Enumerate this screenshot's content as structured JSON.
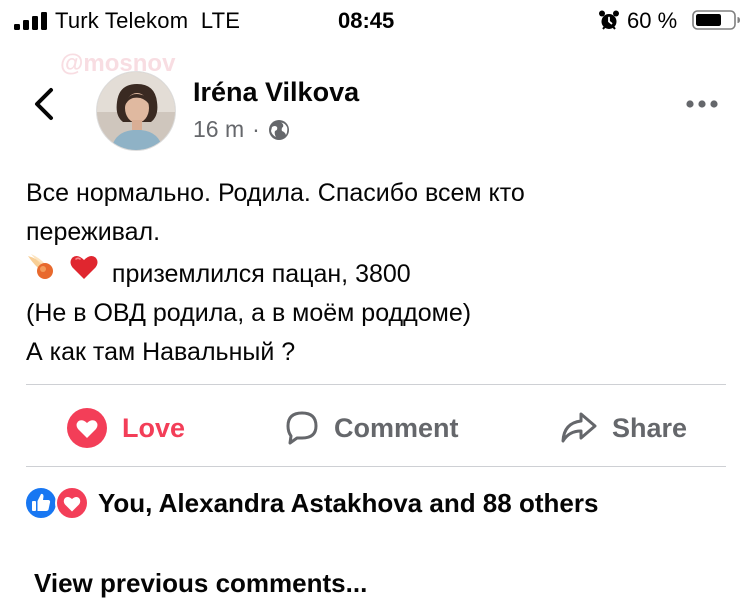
{
  "status_bar": {
    "carrier": "Turk Telekom",
    "network": "LTE",
    "time": "08:45",
    "battery_percent": "60 %"
  },
  "watermark": "@mosnov",
  "post": {
    "author": "Iréna Vilkova",
    "time_ago": "16 m",
    "separator": "·",
    "privacy_icon": "globe-icon",
    "lines": [
      "Все нормально. Родила. Спасибо всем кто",
      "переживал.",
      "приземлился пацан, 3800",
      "(Не в ОВД родила, а в моём роддоме)",
      "А как там Навальный ?"
    ],
    "emojis": [
      "comet-icon",
      "red-heart-icon"
    ]
  },
  "actions": {
    "love": "Love",
    "comment": "Comment",
    "share": "Share"
  },
  "reactions": {
    "summary": "You, Alexandra Astakhova and 88 others",
    "icons": [
      "like-icon",
      "love-icon"
    ]
  },
  "comments": {
    "view_previous": "View previous comments..."
  },
  "colors": {
    "love_red": "#f33e58",
    "facebook_blue": "#1877f2",
    "secondary_text": "#65676b",
    "divider": "#ced0d4"
  }
}
